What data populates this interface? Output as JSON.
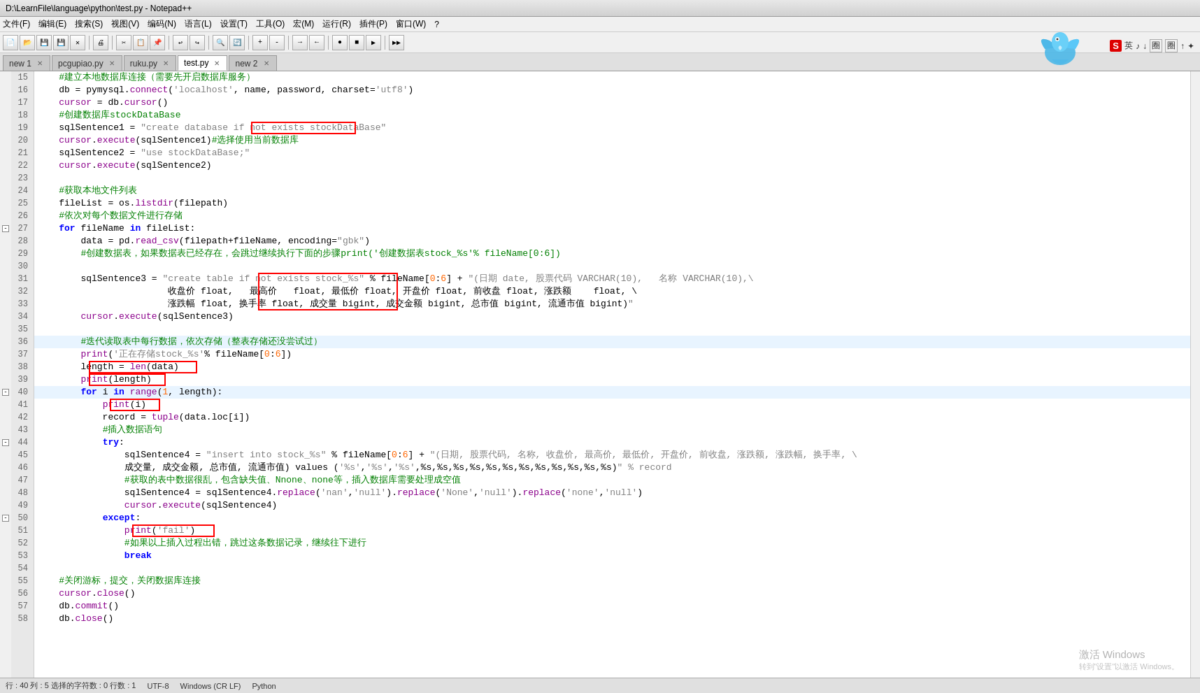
{
  "titleBar": {
    "text": "D:\\LearnFile\\language\\python\\test.py - Notepad++"
  },
  "menuBar": {
    "items": [
      "文件(F)",
      "编辑(E)",
      "搜索(S)",
      "视图(V)",
      "编码(N)",
      "语言(L)",
      "设置(T)",
      "工具(O)",
      "宏(M)",
      "运行(R)",
      "插件(P)",
      "窗口(W)",
      "?"
    ]
  },
  "tabs": [
    {
      "label": "new 1",
      "active": false,
      "modified": false
    },
    {
      "label": "pcgupiao.py",
      "active": false,
      "modified": false
    },
    {
      "label": "ruku.py",
      "active": false,
      "modified": false
    },
    {
      "label": "test.py",
      "active": true,
      "modified": false
    },
    {
      "label": "new 2",
      "active": false,
      "modified": false
    }
  ],
  "statusBar": {
    "lineCol": "行 : 40    列 : 5    选择的字符数 : 0    行数 : 1",
    "encoding": "UTF-8",
    "lineEnding": "Windows (CR LF)",
    "fileType": "Python"
  },
  "codeLines": [
    {
      "num": 15,
      "fold": false,
      "text": "    #建立本地数据库连接（需要先开启数据库服务）",
      "type": "comment",
      "highlighted": false
    },
    {
      "num": 16,
      "fold": false,
      "text": "    db = pymysql.connect('localhost', name, password, charset='utf8')",
      "highlighted": false
    },
    {
      "num": 17,
      "fold": false,
      "text": "    cursor = db.cursor()",
      "highlighted": false
    },
    {
      "num": 18,
      "fold": false,
      "text": "    #创建数据库stockDataBase",
      "type": "comment",
      "highlighted": false
    },
    {
      "num": 19,
      "fold": false,
      "text": "    sqlSentence1 = \"create database if not exists stockDataBase\"",
      "highlighted": false,
      "hasAnnotation": "line19"
    },
    {
      "num": 20,
      "fold": false,
      "text": "    cursor.execute(sqlSentence1)#选择使用当前数据库",
      "highlighted": false
    },
    {
      "num": 21,
      "fold": false,
      "text": "    sqlSentence2 = \"use stockDataBase;\"",
      "highlighted": false
    },
    {
      "num": 22,
      "fold": false,
      "text": "    cursor.execute(sqlSentence2)",
      "highlighted": false
    },
    {
      "num": 23,
      "fold": false,
      "text": "",
      "highlighted": false
    },
    {
      "num": 24,
      "fold": false,
      "text": "    #获取本地文件列表",
      "type": "comment",
      "highlighted": false
    },
    {
      "num": 25,
      "fold": false,
      "text": "    fileList = os.listdir(filepath)",
      "highlighted": false
    },
    {
      "num": 26,
      "fold": false,
      "text": "    #依次对每个数据文件进行存储",
      "type": "comment",
      "highlighted": false
    },
    {
      "num": 27,
      "fold": true,
      "text": "    for fileName in fileList:",
      "highlighted": false
    },
    {
      "num": 28,
      "fold": false,
      "text": "        data = pd.read_csv(filepath+fileName, encoding=\"gbk\")",
      "highlighted": false
    },
    {
      "num": 29,
      "fold": false,
      "text": "        #创建数据表，如果数据表已经存在，会跳过继续执行下面的步骤print('创建数据表stock_%s'% fileName[0:6])",
      "type": "comment",
      "highlighted": false
    },
    {
      "num": 30,
      "fold": false,
      "text": "",
      "highlighted": false
    },
    {
      "num": 31,
      "fold": false,
      "text": "        sqlSentence3 = \"create table if not exists stock_%s\" % fileName[0:6] + \"(日期 date, 股票代码 VARCHAR(10),   名称 VARCHAR(10),\\",
      "highlighted": false,
      "hasAnnotation": "line31"
    },
    {
      "num": 32,
      "fold": false,
      "text": "                        收盘价 float,   最高价   float, 最低价 float, 开盘价 float, 前收盘 float, 涨跌额    float, \\",
      "highlighted": false
    },
    {
      "num": 33,
      "fold": false,
      "text": "                        涨跌幅 float, 换手率 float, 成交量 bigint, 成交金额 bigint, 总市值 bigint, 流通市值 bigint)\"",
      "highlighted": false
    },
    {
      "num": 34,
      "fold": false,
      "text": "        cursor.execute(sqlSentence3)",
      "highlighted": false
    },
    {
      "num": 35,
      "fold": false,
      "text": "",
      "highlighted": false
    },
    {
      "num": 36,
      "fold": false,
      "text": "        #迭代读取表中每行数据，依次存储（整表存储还没尝试过）",
      "type": "comment",
      "highlighted": true
    },
    {
      "num": 37,
      "fold": false,
      "text": "        print('正在存储stock_%s'% fileName[0:6])",
      "highlighted": false
    },
    {
      "num": 38,
      "fold": false,
      "text": "        length = len(data)",
      "highlighted": false,
      "hasAnnotation": "line38"
    },
    {
      "num": 39,
      "fold": false,
      "text": "        print(length)",
      "highlighted": false,
      "hasAnnotation": "line39"
    },
    {
      "num": 40,
      "fold": true,
      "text": "        for i in range(1, length):",
      "highlighted": true
    },
    {
      "num": 41,
      "fold": false,
      "text": "            print(i)",
      "highlighted": false,
      "hasAnnotation": "line41"
    },
    {
      "num": 42,
      "fold": false,
      "text": "            record = tuple(data.loc[i])",
      "highlighted": false
    },
    {
      "num": 43,
      "fold": false,
      "text": "            #插入数据语句",
      "type": "comment",
      "highlighted": false
    },
    {
      "num": 44,
      "fold": true,
      "text": "            try:",
      "highlighted": false
    },
    {
      "num": 45,
      "fold": false,
      "text": "                sqlSentence4 = \"insert into stock_%s\" % fileName[0:6] + \"(日期, 股票代码, 名称, 收盘价, 最高价, 最低价, 开盘价, 前收盘, 涨跌额, 涨跌幅, 换手率, \\",
      "highlighted": false
    },
    {
      "num": 46,
      "fold": false,
      "text": "                成交量, 成交金额, 总市值, 流通市值) values ('%s','%s','%s',%s,%s,%s,%s,%s,%s,%s,%s,%s,%s,%s,%s)\" % record",
      "highlighted": false
    },
    {
      "num": 47,
      "fold": false,
      "text": "                #获取的表中数据很乱，包含缺失值、Nnone、none等，插入数据库需要处理成空值",
      "type": "comment",
      "highlighted": false
    },
    {
      "num": 48,
      "fold": false,
      "text": "                sqlSentence4 = sqlSentence4.replace('nan','null').replace('None','null').replace('none','null')",
      "highlighted": false
    },
    {
      "num": 49,
      "fold": false,
      "text": "                cursor.execute(sqlSentence4)",
      "highlighted": false
    },
    {
      "num": 50,
      "fold": true,
      "text": "            except:",
      "highlighted": false
    },
    {
      "num": 51,
      "fold": false,
      "text": "                print('fail')",
      "highlighted": false,
      "hasAnnotation": "line51"
    },
    {
      "num": 52,
      "fold": false,
      "text": "                #如果以上插入过程出错，跳过这条数据记录，继续往下进行",
      "type": "comment",
      "highlighted": false
    },
    {
      "num": 53,
      "fold": false,
      "text": "                break",
      "highlighted": false
    },
    {
      "num": 54,
      "fold": false,
      "text": "",
      "highlighted": false
    },
    {
      "num": 55,
      "fold": false,
      "text": "    #关闭游标，提交，关闭数据库连接",
      "type": "comment",
      "highlighted": false
    },
    {
      "num": 56,
      "fold": false,
      "text": "    cursor.close()",
      "highlighted": false
    },
    {
      "num": 57,
      "fold": false,
      "text": "    db.commit()",
      "highlighted": false
    },
    {
      "num": 58,
      "fold": false,
      "text": "    db.close()",
      "highlighted": false
    }
  ],
  "watermark": "激活 Windows\n转到\"设置\"以激活 Windows。",
  "tray": {
    "label": "英♪↓圈圈↑✦"
  },
  "annotations": {
    "line19_label": "if not exists",
    "line31_label": "if not exists stock"
  }
}
